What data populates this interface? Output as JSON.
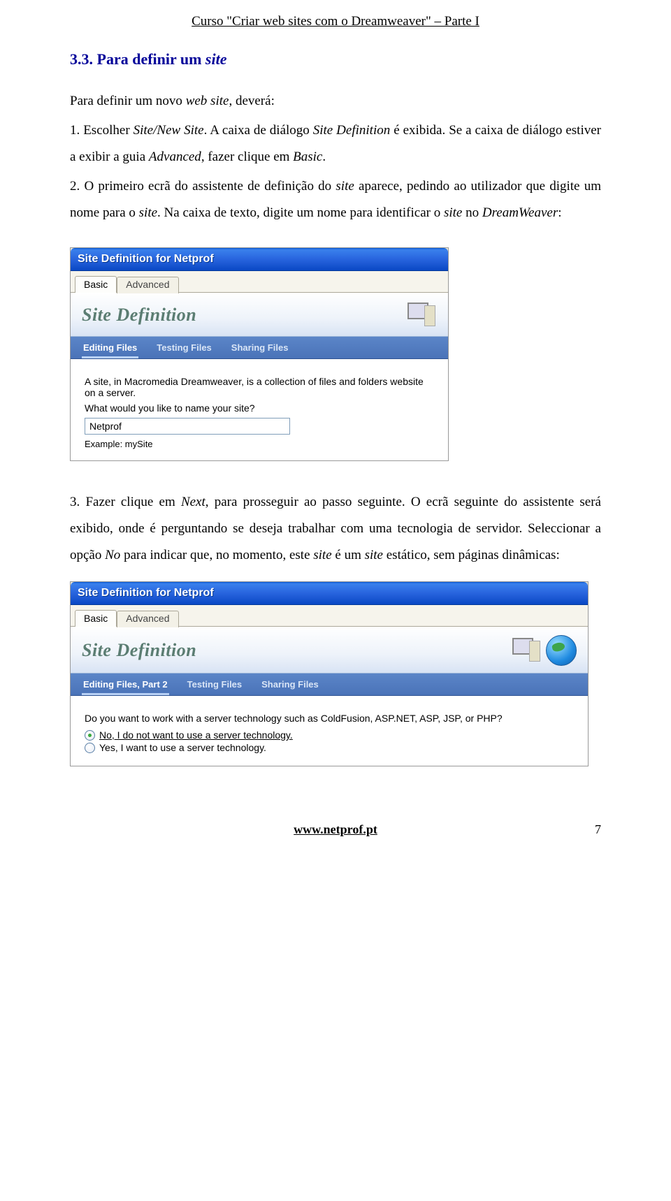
{
  "header": "Curso \"Criar web sites com o Dreamweaver\" – Parte I",
  "section_number": "3.3.",
  "section_title_prefix": "Para definir um ",
  "section_title_italic": "site",
  "para1a": "Para definir um novo ",
  "para1b": "web site",
  "para1c": ", deverá:",
  "step1a": "1. Escolher ",
  "step1b": "Site/New Site",
  "step1c": ". A caixa de diálogo ",
  "step1d": "Site Definition ",
  "step1e": "é exibida. Se a caixa de diálogo estiver a exibir a guia ",
  "step1f": "Advanced",
  "step1g": ", fazer clique em ",
  "step1h": "Basic",
  "step1i": ".",
  "step2a": "2. O primeiro ecrã do assistente de definição do ",
  "step2b": "site",
  "step2c": " aparece, pedindo ao utilizador que digite um nome para o ",
  "step2d": "site",
  "step2e": ". Na caixa de texto, digite um nome para identificar o ",
  "step2f": "site",
  "step2g": " no ",
  "step2h": "DreamWeaver",
  "step2i": ":",
  "dlg1": {
    "title": "Site Definition for Netprof",
    "tab_basic": "Basic",
    "tab_advanced": "Advanced",
    "banner_title": "Site Definition",
    "subtabs": {
      "editing": "Editing Files",
      "testing": "Testing Files",
      "sharing": "Sharing Files"
    },
    "intro": "A site, in Macromedia Dreamweaver, is a collection of files and folders website on a server.",
    "question": "What would you like to name your site?",
    "value": "Netprof",
    "example": "Example: mySite"
  },
  "step3a": "3. Fazer clique em ",
  "step3b": "Next",
  "step3c": ", para prosseguir ao passo seguinte. O ecrã seguinte do assistente será exibido, onde é perguntando se deseja trabalhar com uma tecnologia de servidor. Seleccionar a opção ",
  "step3d": "No",
  "step3e": " para indicar que, no momento, este ",
  "step3f": "site",
  "step3g": " é um ",
  "step3h": "site",
  "step3i": " estático, sem páginas dinâmicas:",
  "dlg2": {
    "title": "Site Definition for Netprof",
    "tab_basic": "Basic",
    "tab_advanced": "Advanced",
    "banner_title": "Site Definition",
    "subtabs": {
      "editing": "Editing Files, Part 2",
      "testing": "Testing Files",
      "sharing": "Sharing Files"
    },
    "question": "Do you want to work with a server technology such as ColdFusion, ASP.NET, ASP, JSP, or PHP?",
    "opt_no": "No, I do not want to use a server technology.",
    "opt_yes": "Yes, I want to use a server technology."
  },
  "footer_site": "www.netprof.pt",
  "footer_page": "7"
}
